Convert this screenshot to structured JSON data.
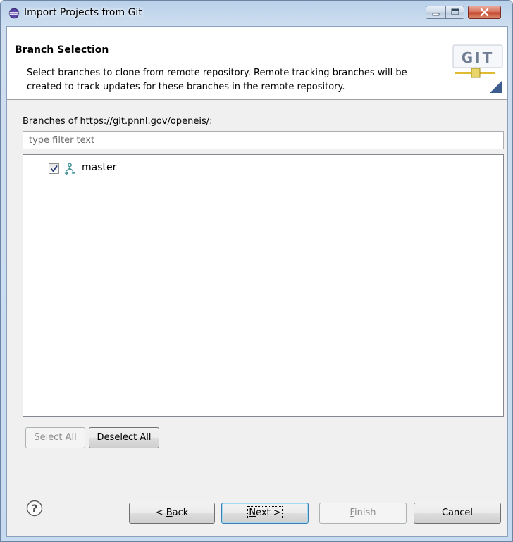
{
  "window": {
    "title": "Import Projects from Git"
  },
  "banner": {
    "title": "Branch Selection",
    "description": "Select branches to clone from remote repository. Remote tracking branches will be created to track updates for these branches in the remote repository.",
    "logo_text": "GIT"
  },
  "branches": {
    "label_prefix": "Branches ",
    "label_mnemonic": "o",
    "label_suffix": "f https://git.pnnl.gov/openeis/:",
    "filter_placeholder": "type filter text",
    "items": [
      {
        "label": "master",
        "checked": true,
        "icon": "branch-icon"
      }
    ]
  },
  "selection_buttons": {
    "select_all_mnemonic": "S",
    "select_all_rest": "elect All",
    "deselect_all_mnemonic": "D",
    "deselect_all_rest": "eselect All"
  },
  "footer": {
    "help_icon": "help-icon",
    "back_prefix": "< ",
    "back_mnemonic": "B",
    "back_rest": "ack",
    "next_mnemonic": "N",
    "next_rest": "ext >",
    "finish_mnemonic": "F",
    "finish_rest": "inish",
    "cancel_label": "Cancel"
  },
  "colors": {
    "accent": "#3c7fb1",
    "branch_icon": "#3d8f93",
    "git_logo": "#6f7e93"
  }
}
